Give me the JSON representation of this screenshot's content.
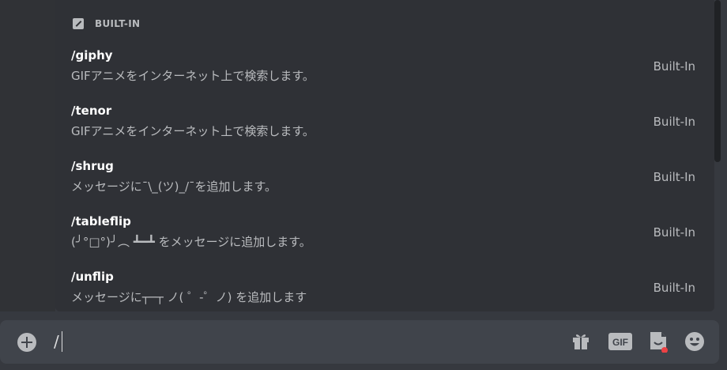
{
  "autocomplete": {
    "section_title": "BUILT-IN",
    "commands": [
      {
        "name": "/giphy",
        "description": "GIFアニメをインターネット上で検索します。",
        "tag": "Built-In"
      },
      {
        "name": "/tenor",
        "description": "GIFアニメをインターネット上で検索します。",
        "tag": "Built-In"
      },
      {
        "name": "/shrug",
        "description": "メッセージに¯\\_(ツ)_/¯を追加します。",
        "tag": "Built-In"
      },
      {
        "name": "/tableflip",
        "description": "(╯°□°)╯︵ ┻━┻ をメッセージに追加します。",
        "tag": "Built-In"
      },
      {
        "name": "/unflip",
        "description": "メッセージに┬─┬ ノ( ゜-゜ノ) を追加します",
        "tag": "Built-In"
      }
    ]
  },
  "composer": {
    "input_value": "/",
    "icons": [
      "add-icon",
      "gift-icon",
      "gif-icon",
      "sticker-icon",
      "emoji-icon"
    ],
    "gif_label": "GIF"
  },
  "colors": {
    "background": "#36393f",
    "popup": "#2f3136",
    "input": "#40444b",
    "text_primary": "#ffffff",
    "text_muted": "#b9bbbe",
    "notification_dot": "#ed4245"
  }
}
